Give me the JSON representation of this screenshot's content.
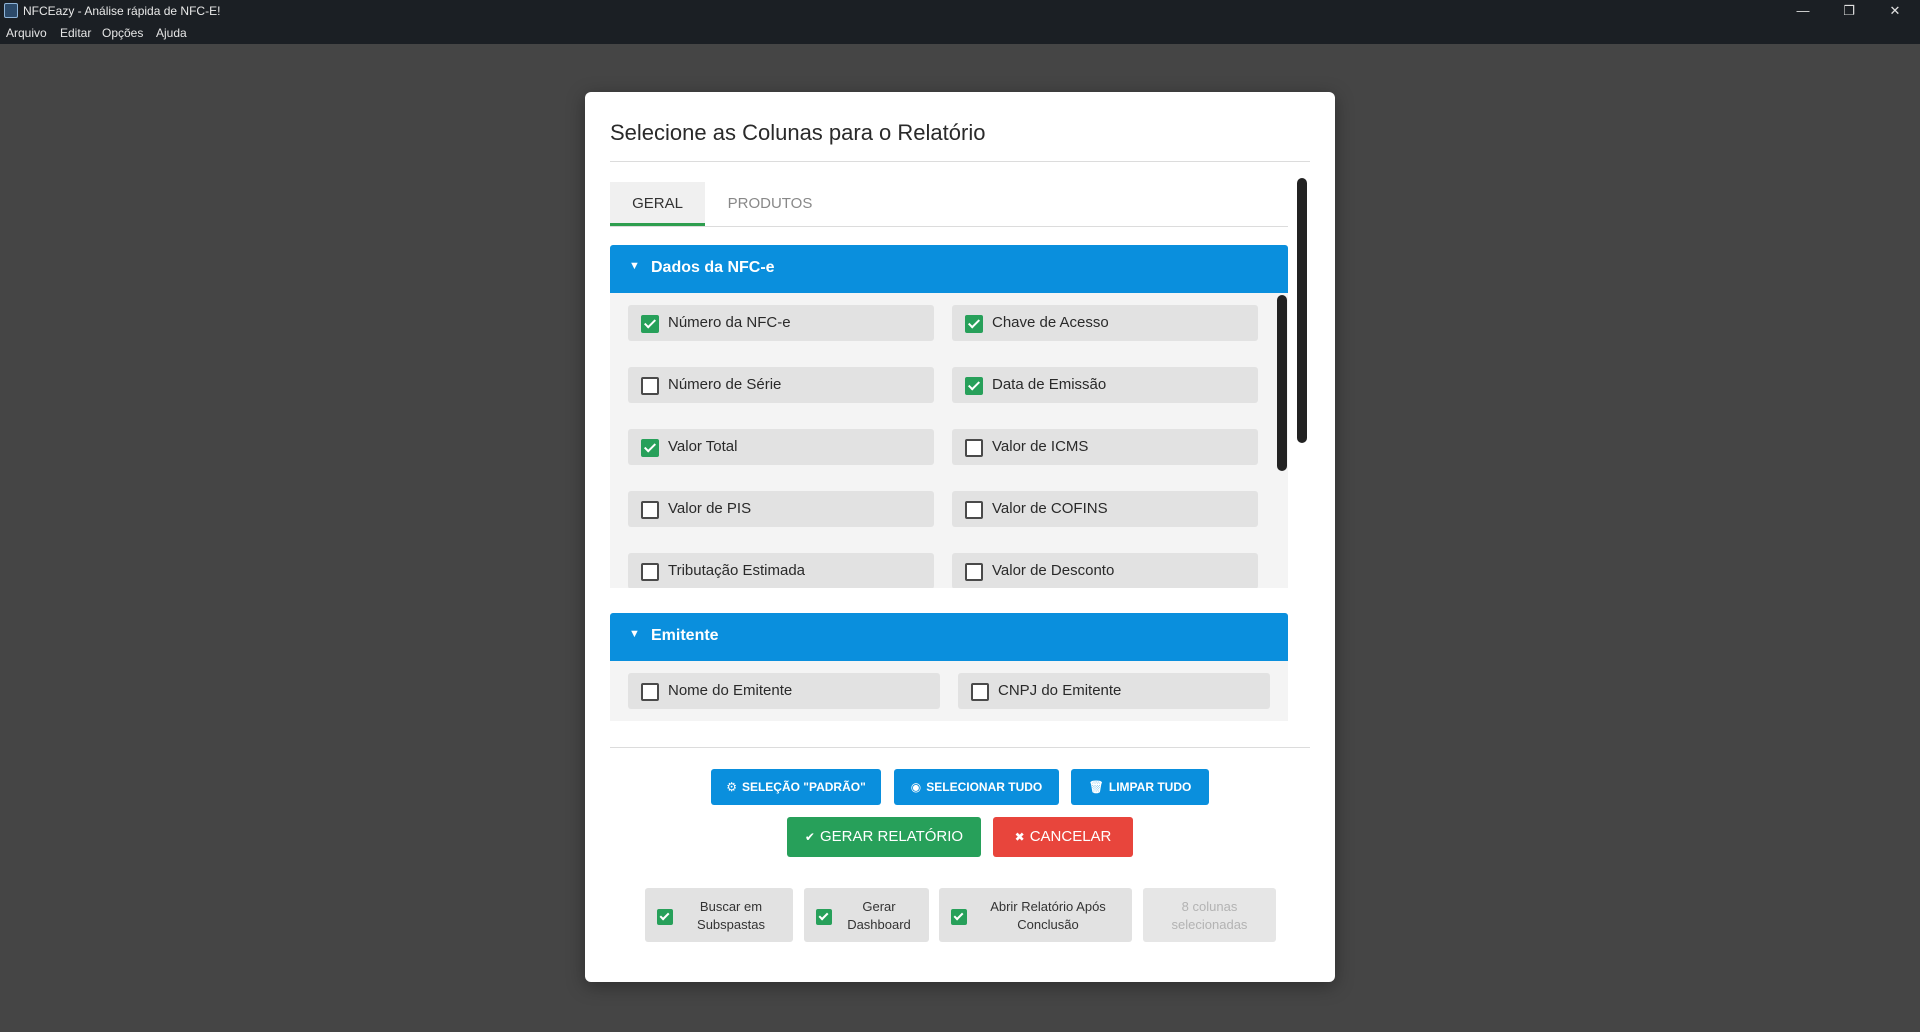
{
  "window": {
    "title": "NFCEazy - Análise rápida de NFC-E!",
    "minimize": "—",
    "restore": "❐",
    "close": "✕"
  },
  "menu": [
    "Arquivo",
    "Editar",
    "Opções",
    "Ajuda"
  ],
  "dialog": {
    "title": "Selecione as Colunas para o Relatório",
    "tabs": [
      "GERAL",
      "PRODUTOS"
    ],
    "sections": [
      {
        "title": "Dados da NFC-e",
        "options": [
          {
            "label": "Número da NFC-e",
            "checked": true
          },
          {
            "label": "Chave de Acesso",
            "checked": true
          },
          {
            "label": "Número de Série",
            "checked": false
          },
          {
            "label": "Data de Emissão",
            "checked": true
          },
          {
            "label": "Valor Total",
            "checked": true
          },
          {
            "label": "Valor de ICMS",
            "checked": false
          },
          {
            "label": "Valor de PIS",
            "checked": false
          },
          {
            "label": "Valor de COFINS",
            "checked": false
          },
          {
            "label": "Tributação Estimada",
            "checked": false
          },
          {
            "label": "Valor de Desconto",
            "checked": false
          }
        ]
      },
      {
        "title": "Emitente",
        "options": [
          {
            "label": "Nome do Emitente",
            "checked": false
          },
          {
            "label": "CNPJ do Emitente",
            "checked": false
          }
        ]
      }
    ],
    "buttons": {
      "default_selection": "SELEÇÃO \"PADRÃO\"",
      "select_all": "SELECIONAR TUDO",
      "clear_all": "LIMPAR TUDO",
      "generate": "GERAR RELATÓRIO",
      "cancel": "CANCELAR"
    },
    "toggles": [
      {
        "label_line1": "Buscar em",
        "label_line2": "Subspastas",
        "checked": true
      },
      {
        "label_line1": "Gerar",
        "label_line2": "Dashboard",
        "checked": true
      },
      {
        "label_line1": "Abrir Relatório Após",
        "label_line2": "Conclusão",
        "checked": true
      }
    ],
    "status": {
      "line1": "8 colunas",
      "line2": "selecionadas"
    }
  },
  "colors": {
    "accent_blue": "#0a8fdd",
    "success_green": "#27a05a",
    "danger_red": "#e8453c",
    "backdrop": "#454545"
  }
}
